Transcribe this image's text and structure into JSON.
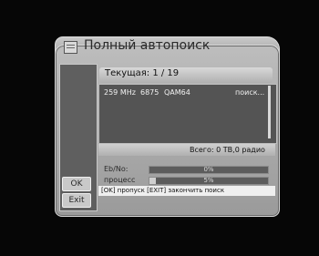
{
  "dialog": {
    "title": "Полный автопоиск"
  },
  "current": {
    "label": "Текущая: 1 / 19"
  },
  "scan_row": {
    "frequency": "259 MHz",
    "symbol_rate": "6875",
    "modulation": "QAM64",
    "status": "поиск..."
  },
  "totals": {
    "text": "Всего: 0 ТВ,0 радио"
  },
  "signal": {
    "ebno_label": "Eb/No:",
    "ebno_value": "0%",
    "ebno_percent": 0
  },
  "progress": {
    "label": "процесс",
    "value": "5%",
    "percent": 5
  },
  "buttons": {
    "ok": "OK",
    "exit": "Exit"
  },
  "hint": {
    "text": "[OK] пропуск [EXIT] закончить поиск"
  }
}
